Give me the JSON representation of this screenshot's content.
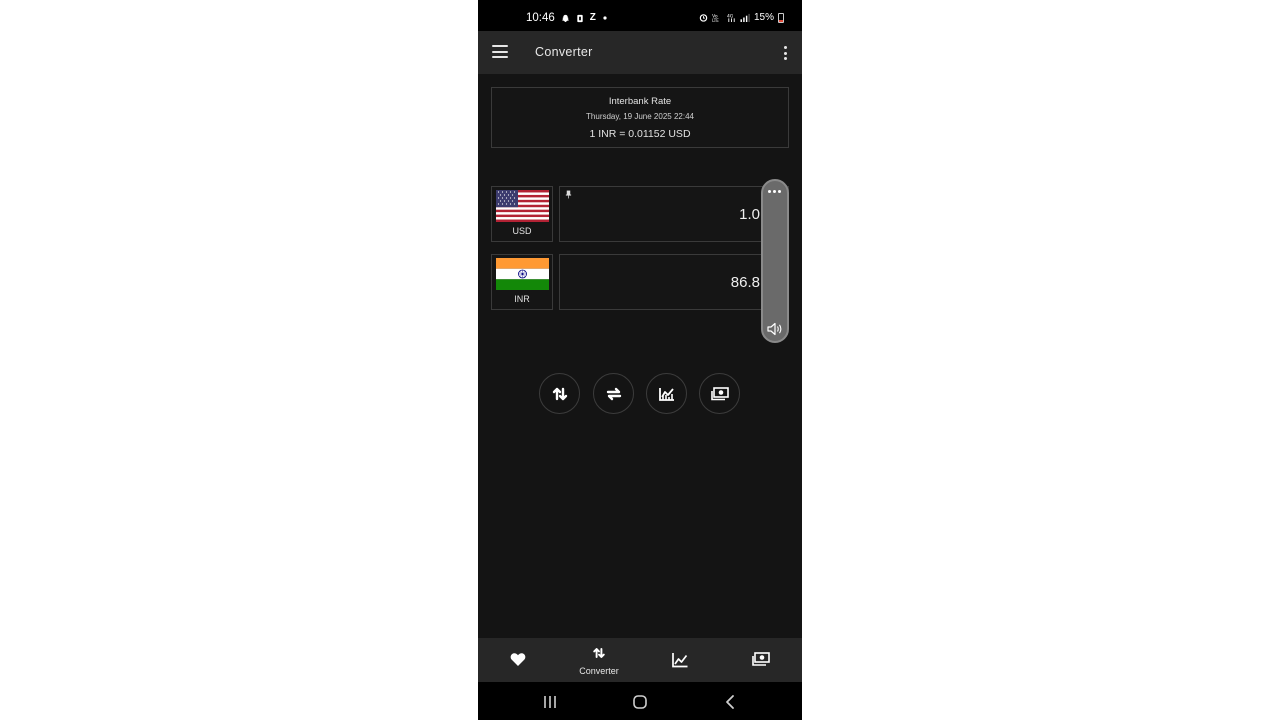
{
  "status_bar": {
    "time": "10:46",
    "left_icons": [
      "snapchat-icon",
      "notification-icon",
      "z-icon",
      "dot-icon"
    ],
    "right_icons": [
      "alarm-icon",
      "volte-icon",
      "wifi-calling-icon",
      "signal-icon"
    ],
    "battery": "15%"
  },
  "app_bar": {
    "title": "Converter"
  },
  "rate_card": {
    "title": "Interbank Rate",
    "date": "Thursday, 19 June 2025 22:44",
    "rate": "1 INR = 0.01152 USD"
  },
  "currencies": [
    {
      "code": "USD",
      "amount": "1.0",
      "flag": "us-flag-icon",
      "pinned": true
    },
    {
      "code": "INR",
      "amount": "86.8",
      "flag": "india-flag-icon",
      "pinned": false
    }
  ],
  "action_buttons": [
    "swap-vertical-icon",
    "swap-horizontal-icon",
    "chart-icon",
    "money-icon"
  ],
  "bottom_nav": {
    "items": [
      {
        "icon": "heart-icon",
        "label": ""
      },
      {
        "icon": "converter-icon",
        "label": "Converter"
      },
      {
        "icon": "chart-icon",
        "label": ""
      },
      {
        "icon": "money-icon",
        "label": ""
      }
    ]
  },
  "colors": {
    "background": "#141414",
    "app_bar": "#272727",
    "border": "#3a3a3a",
    "text": "#e2e2e2"
  }
}
